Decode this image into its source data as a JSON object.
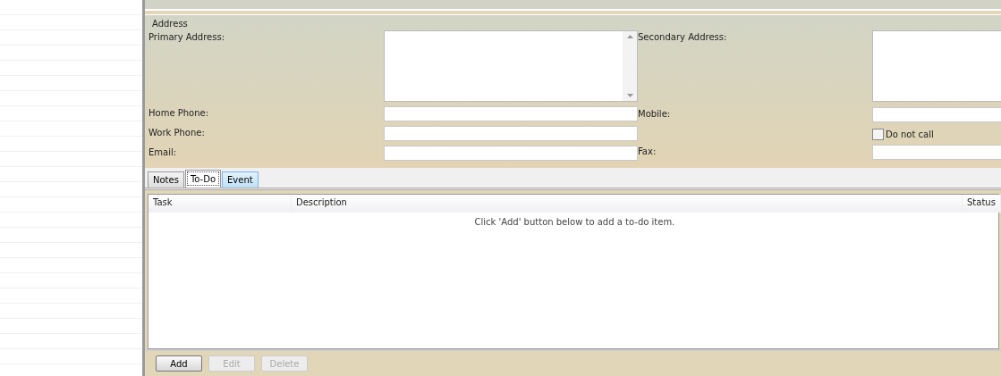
{
  "address": {
    "legend": "Address",
    "left": [
      {
        "label": "Primary Address:",
        "kind": "textarea"
      },
      {
        "label": "Home Phone:",
        "kind": "text"
      },
      {
        "label": "Work Phone:",
        "kind": "text"
      },
      {
        "label": "Email:",
        "kind": "text"
      }
    ],
    "right": [
      {
        "label": "Secondary Address:",
        "kind": "textarea"
      },
      {
        "label": "Mobile:",
        "kind": "text"
      },
      {
        "label": "Do not call",
        "kind": "checkbox",
        "checked": false
      },
      {
        "label": "Fax:",
        "kind": "text"
      }
    ]
  },
  "tabs": [
    {
      "label": "Notes",
      "selected": false,
      "hovered": false
    },
    {
      "label": "To-Do",
      "selected": true,
      "hovered": false
    },
    {
      "label": "Event",
      "selected": false,
      "hovered": true
    }
  ],
  "table": {
    "columns": [
      "Task",
      "Description",
      "Status"
    ],
    "empty_message": "Click 'Add' button below to add a to-do item."
  },
  "buttons": [
    {
      "label": "Add",
      "disabled": false
    },
    {
      "label": "Edit",
      "disabled": true
    },
    {
      "label": "Delete",
      "disabled": true
    }
  ]
}
